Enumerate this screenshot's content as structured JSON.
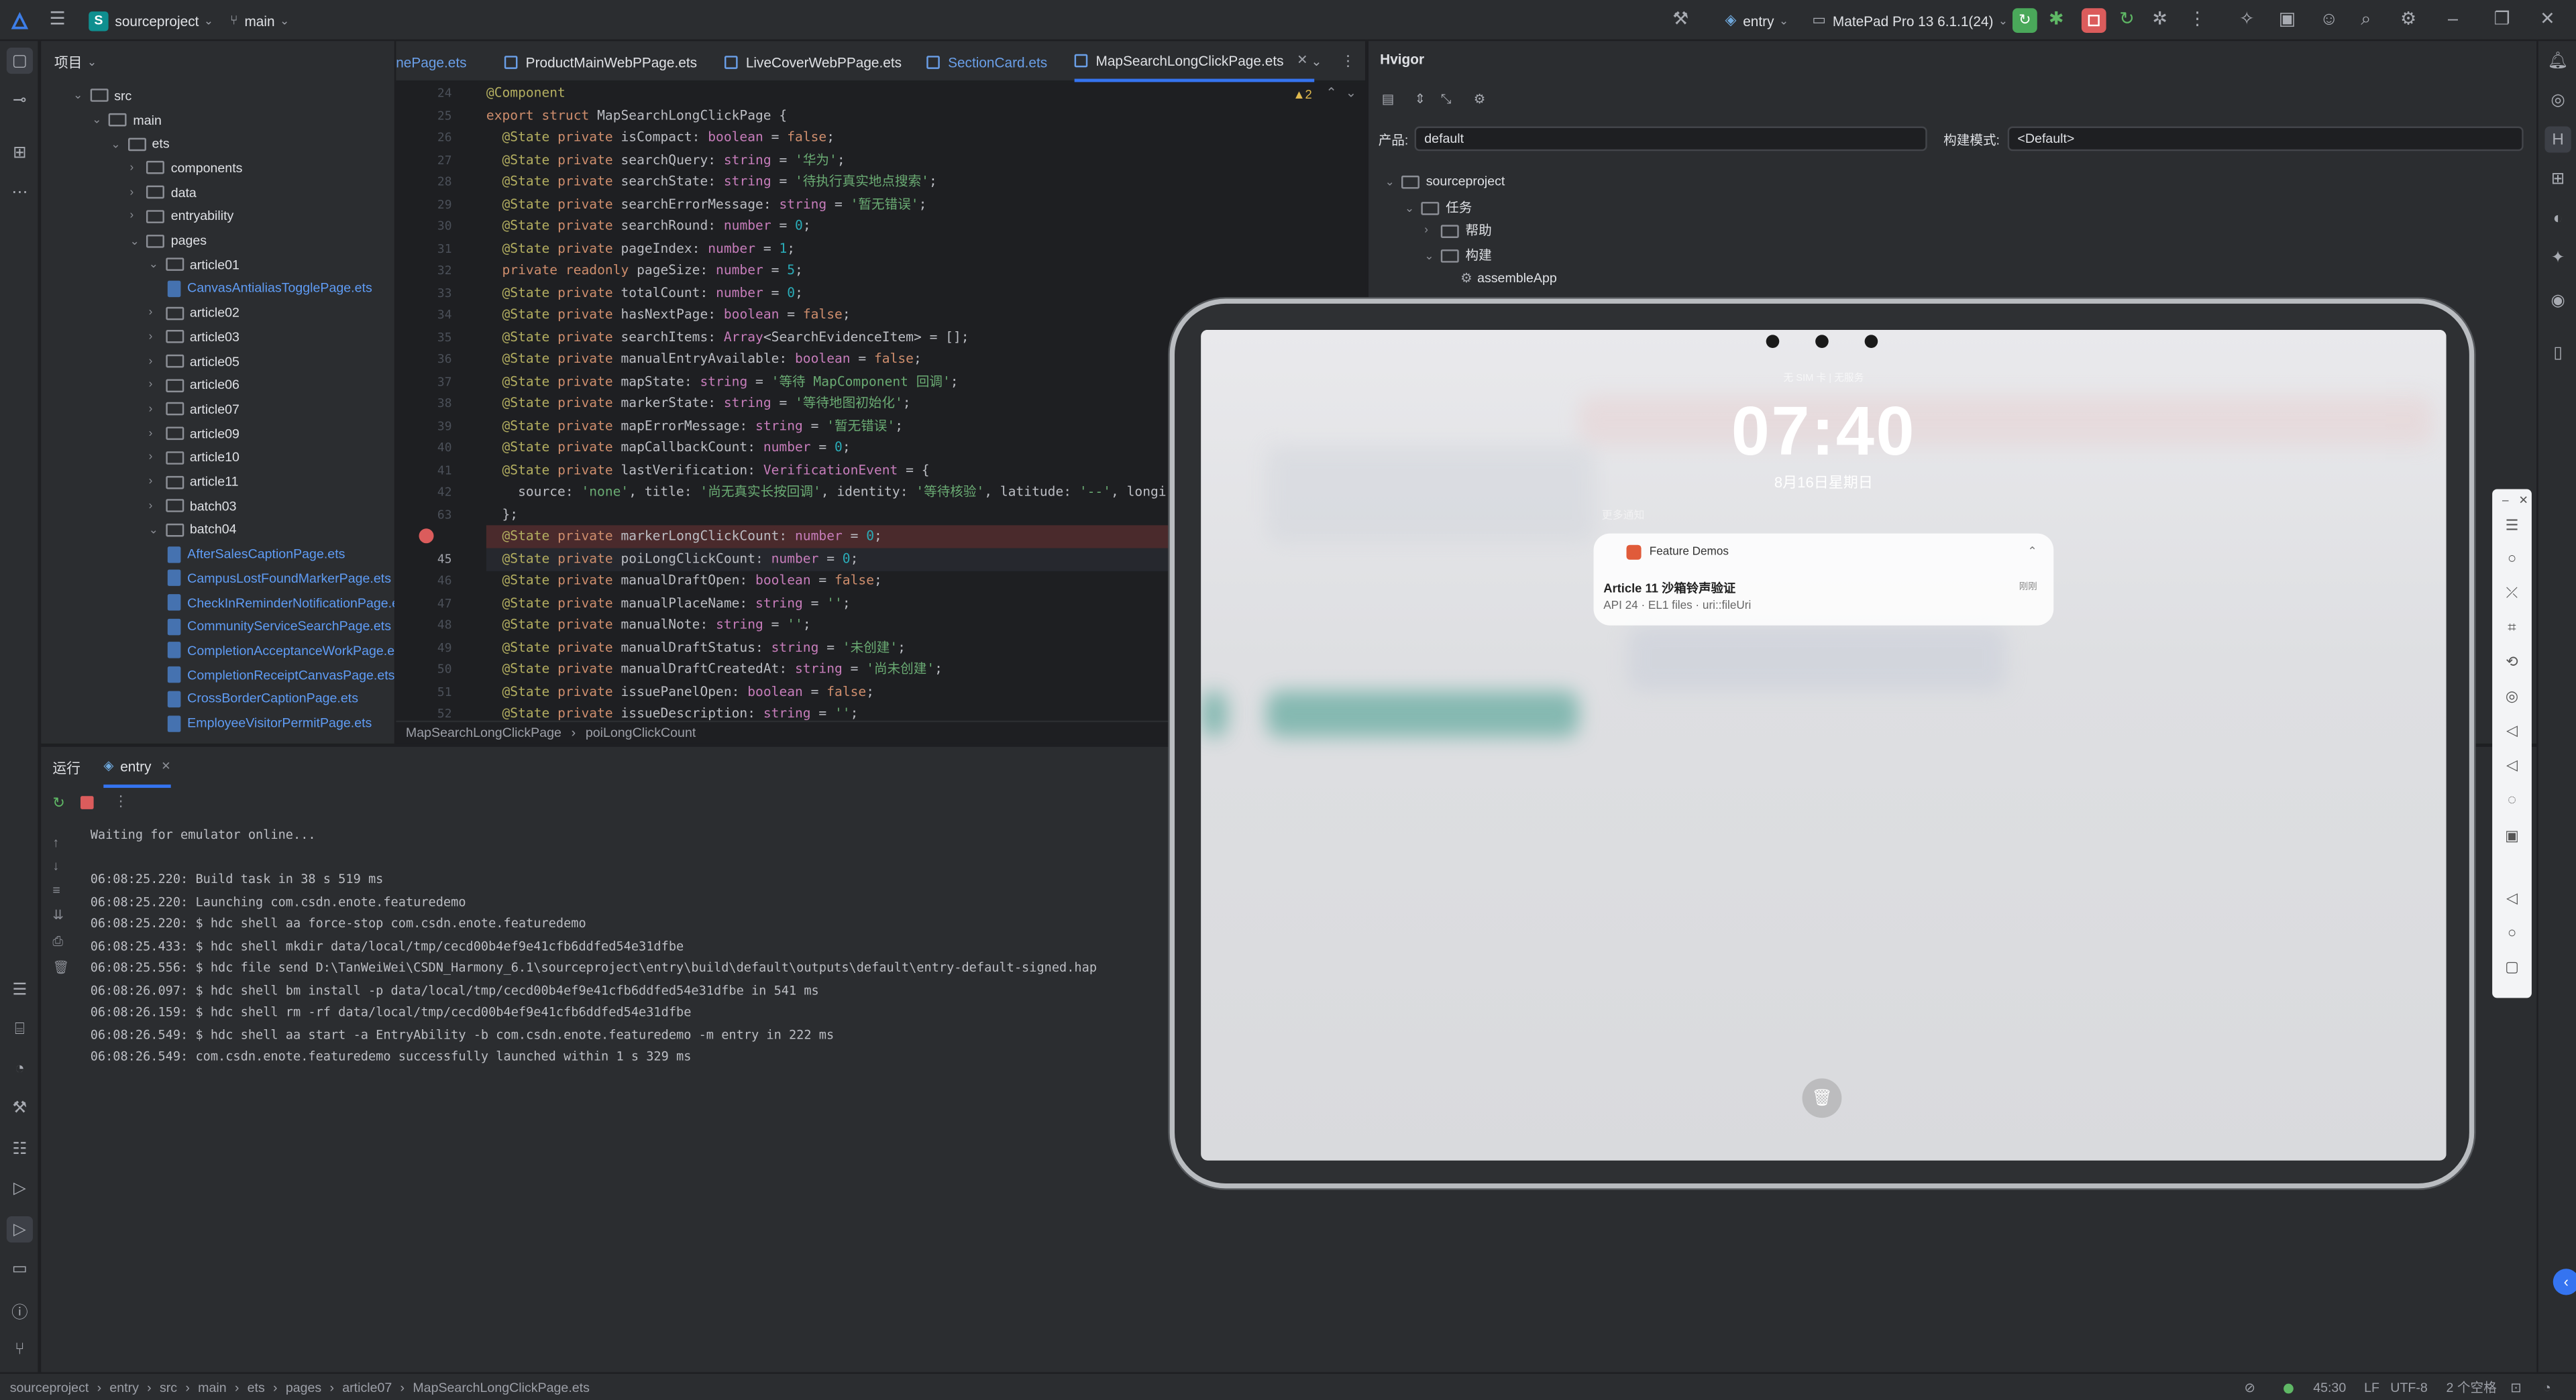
{
  "topbar": {
    "project_name": "sourceproject",
    "project_badge": "S",
    "branch": "main",
    "run_config": "entry",
    "device": "MatePad Pro 13 6.1.1(24)"
  },
  "project_panel": {
    "title": "项目",
    "tree": [
      {
        "label": "src",
        "depth": 1,
        "kind": "folder",
        "open": true
      },
      {
        "label": "main",
        "depth": 2,
        "kind": "folder",
        "open": true
      },
      {
        "label": "ets",
        "depth": 3,
        "kind": "folder",
        "open": true
      },
      {
        "label": "components",
        "depth": 4,
        "kind": "folder",
        "open": false
      },
      {
        "label": "data",
        "depth": 4,
        "kind": "folder",
        "open": false
      },
      {
        "label": "entryability",
        "depth": 4,
        "kind": "folder",
        "open": false
      },
      {
        "label": "pages",
        "depth": 4,
        "kind": "folder",
        "open": true
      },
      {
        "label": "article01",
        "depth": 5,
        "kind": "folder",
        "open": true
      },
      {
        "label": "CanvasAntialiasTogglePage.ets",
        "depth": 6,
        "kind": "file"
      },
      {
        "label": "article02",
        "depth": 5,
        "kind": "folder",
        "open": false
      },
      {
        "label": "article03",
        "depth": 5,
        "kind": "folder",
        "open": false
      },
      {
        "label": "article05",
        "depth": 5,
        "kind": "folder",
        "open": false
      },
      {
        "label": "article06",
        "depth": 5,
        "kind": "folder",
        "open": false
      },
      {
        "label": "article07",
        "depth": 5,
        "kind": "folder",
        "open": false
      },
      {
        "label": "article09",
        "depth": 5,
        "kind": "folder",
        "open": false
      },
      {
        "label": "article10",
        "depth": 5,
        "kind": "folder",
        "open": false
      },
      {
        "label": "article11",
        "depth": 5,
        "kind": "folder",
        "open": false
      },
      {
        "label": "batch03",
        "depth": 5,
        "kind": "folder",
        "open": false
      },
      {
        "label": "batch04",
        "depth": 5,
        "kind": "folder",
        "open": true
      },
      {
        "label": "AfterSalesCaptionPage.ets",
        "depth": 6,
        "kind": "file"
      },
      {
        "label": "CampusLostFoundMarkerPage.ets",
        "depth": 6,
        "kind": "file"
      },
      {
        "label": "CheckInReminderNotificationPage.ets",
        "depth": 6,
        "kind": "file"
      },
      {
        "label": "CommunityServiceSearchPage.ets",
        "depth": 6,
        "kind": "file"
      },
      {
        "label": "CompletionAcceptanceWorkPage.ets",
        "depth": 6,
        "kind": "file"
      },
      {
        "label": "CompletionReceiptCanvasPage.ets",
        "depth": 6,
        "kind": "file"
      },
      {
        "label": "CrossBorderCaptionPage.ets",
        "depth": 6,
        "kind": "file"
      },
      {
        "label": "EmployeeVisitorPermitPage.ets",
        "depth": 6,
        "kind": "file"
      }
    ]
  },
  "editor": {
    "tabs": [
      {
        "label": "nePage.ets",
        "active": false
      },
      {
        "label": "ProductMainWebPPage.ets",
        "active": false
      },
      {
        "label": "LiveCoverWebPPage.ets",
        "active": false
      },
      {
        "label": "SectionCard.ets",
        "active": false
      },
      {
        "label": "MapSearchLongClickPage.ets",
        "active": true
      }
    ],
    "warnings": "▲2",
    "line_numbers": [
      "24",
      "25",
      "26",
      "27",
      "28",
      "29",
      "30",
      "31",
      "32",
      "33",
      "34",
      "35",
      "36",
      "37",
      "38",
      "39",
      "40",
      "41",
      "42",
      "63",
      "",
      "45",
      "46",
      "47",
      "48",
      "49",
      "50",
      "51",
      "52"
    ],
    "lines": [
      "@Component",
      "export struct MapSearchLongClickPage {",
      "  @State private isCompact: boolean = false;",
      "  @State private searchQuery: string = '华为';",
      "  @State private searchState: string = '待执行真实地点搜索';",
      "  @State private searchErrorMessage: string = '暂无错误';",
      "  @State private searchRound: number = 0;",
      "  @State private pageIndex: number = 1;",
      "  private readonly pageSize: number = 5;",
      "  @State private totalCount: number = 0;",
      "  @State private hasNextPage: boolean = false;",
      "  @State private searchItems: Array<SearchEvidenceItem> = [];",
      "  @State private manualEntryAvailable: boolean = false;",
      "  @State private mapState: string = '等待 MapComponent 回调';",
      "  @State private markerState: string = '等待地图初始化';",
      "  @State private mapErrorMessage: string = '暂无错误';",
      "  @State private mapCallbackCount: number = 0;",
      "  @State private lastVerification: VerificationEvent = {",
      "    source: 'none', title: '尚无真实长按回调', identity: '等待核验', latitude: '--', longi",
      "  };",
      "  @State private markerLongClickCount: number = 0;",
      "  @State private poiLongClickCount: number = 0;",
      "  @State private manualDraftOpen: boolean = false;",
      "  @State private manualPlaceName: string = '';",
      "  @State private manualNote: string = '';",
      "  @State private manualDraftStatus: string = '未创建';",
      "  @State private manualDraftCreatedAt: string = '尚未创建';",
      "  @State private issuePanelOpen: boolean = false;",
      "  @State private issueDescription: string = '';"
    ],
    "breadcrumb": [
      "MapSearchLongClickPage",
      "poiLongClickCount"
    ]
  },
  "hvigor": {
    "title": "Hvigor",
    "product_label": "产品:",
    "product_value": "default",
    "build_mode_label": "构建模式:",
    "build_mode_value": "<Default>",
    "tree": [
      "sourceproject",
      "任务",
      "帮助",
      "构建",
      "assembleApp"
    ]
  },
  "run_panel": {
    "tab_run": "运行",
    "tab_entry": "entry",
    "console": [
      "Waiting for emulator online...",
      "",
      "06:08:25.220: Build task in 38 s 519 ms",
      "06:08:25.220: Launching com.csdn.enote.featuredemo",
      "06:08:25.220: $ hdc shell aa force-stop com.csdn.enote.featuredemo",
      "06:08:25.433: $ hdc shell mkdir data/local/tmp/cecd00b4ef9e41cfb6ddfed54e31dfbe",
      "06:08:25.556: $ hdc file send D:\\TanWeiWei\\CSDN_Harmony_6.1\\sourceproject\\entry\\build\\default\\outputs\\default\\entry-default-signed.hap",
      "06:08:26.097: $ hdc shell bm install -p data/local/tmp/cecd00b4ef9e41cfb6ddfed54e31dfbe in 541 ms",
      "06:08:26.159: $ hdc shell rm -rf data/local/tmp/cecd00b4ef9e41cfb6ddfed54e31dfbe",
      "06:08:26.549: $ hdc shell aa start -a EntryAbility -b com.csdn.enote.featuredemo -m entry in 222 ms",
      "06:08:26.549: com.csdn.enote.featuredemo successfully launched within 1 s 329 ms"
    ]
  },
  "device": {
    "status": "无 SIM 卡 | 无服务",
    "time": "07:40",
    "date": "8月16日星期日",
    "more_notifications": "更多通知",
    "notification": {
      "app": "Feature Demos",
      "title": "Article 11 沙箱铃声验证",
      "subtitle": "API 24 · EL1 files · uri::fileUri",
      "time": "刚刚"
    }
  },
  "statusbar": {
    "breadcrumb": [
      "sourceproject",
      "entry",
      "src",
      "main",
      "ets",
      "pages",
      "article07",
      "MapSearchLongClickPage.ets"
    ],
    "position": "45:30",
    "line_sep": "LF",
    "encoding": "UTF-8",
    "indent": "2 个空格"
  },
  "colors": {
    "accent": "#3574f0",
    "run_green": "#4aa85a",
    "stop_red": "#db5c5c"
  }
}
